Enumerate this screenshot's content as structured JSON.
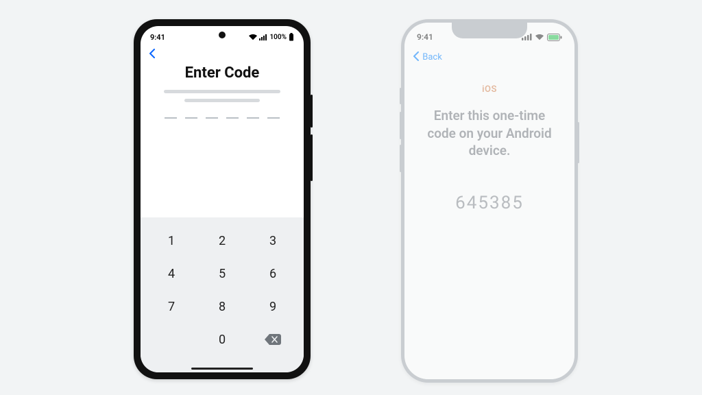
{
  "android": {
    "status": {
      "time": "9:41",
      "battery_label": "100%"
    },
    "title": "Enter Code",
    "code_length": 6,
    "keypad": {
      "k1": "1",
      "k2": "2",
      "k3": "3",
      "k4": "4",
      "k5": "5",
      "k6": "6",
      "k7": "7",
      "k8": "8",
      "k9": "9",
      "k0": "0"
    }
  },
  "ios": {
    "status": {
      "time": "9:41"
    },
    "nav": {
      "back_label": "Back"
    },
    "brand": "iOS",
    "message": "Enter this one-time code on your Android device.",
    "code": "645385"
  }
}
